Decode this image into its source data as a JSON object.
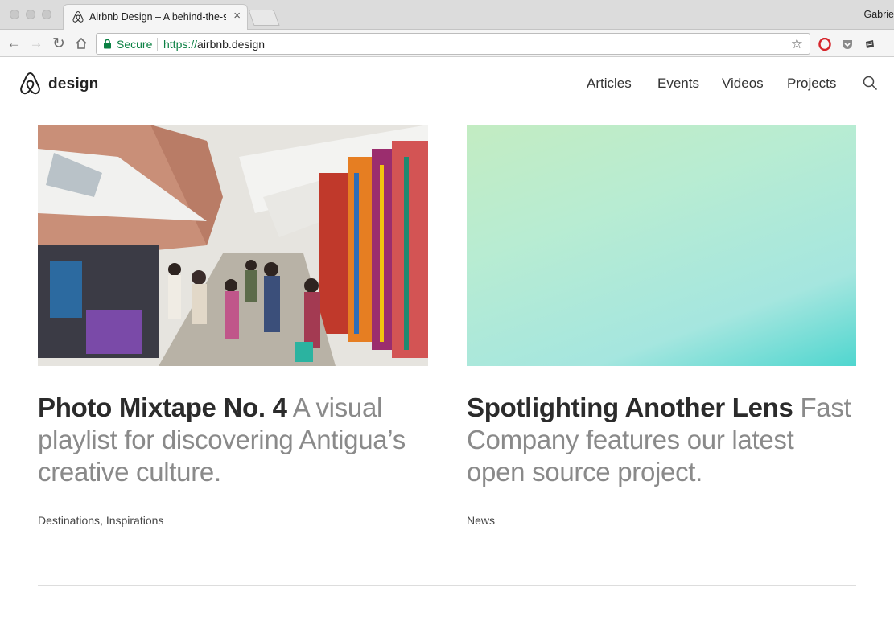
{
  "browser": {
    "tab_title": "Airbnb Design – A behind-the-scenes look",
    "tab_close": "×",
    "user_name": "Gabrie",
    "secure_label": "Secure",
    "url_scheme": "https://",
    "url_host": "airbnb.design",
    "star_glyph": "☆",
    "back_glyph": "←",
    "forward_glyph": "→",
    "reload_glyph": "↻"
  },
  "site": {
    "logo_text": "design",
    "nav": [
      {
        "label": "Articles"
      },
      {
        "label": "Events"
      },
      {
        "label": "Videos"
      },
      {
        "label": "Projects"
      }
    ]
  },
  "articles": [
    {
      "title": "Photo Mixtape No. 4",
      "subtitle": " A visual playlist for discovering Antigua’s creative culture.",
      "tags": "Destinations, Inspirations",
      "image": "market-photo"
    },
    {
      "title": "Spotlighting Another Lens",
      "subtitle": " Fast Company features our latest open source project.",
      "tags": "News",
      "image": "gradient-image"
    }
  ],
  "colors": {
    "secure_green": "#0b8043",
    "title_text": "#2b2b2b",
    "subtitle_text": "#8a8a8a",
    "gradient_start": "#c3ecc2",
    "gradient_end": "#4fd6cf"
  }
}
